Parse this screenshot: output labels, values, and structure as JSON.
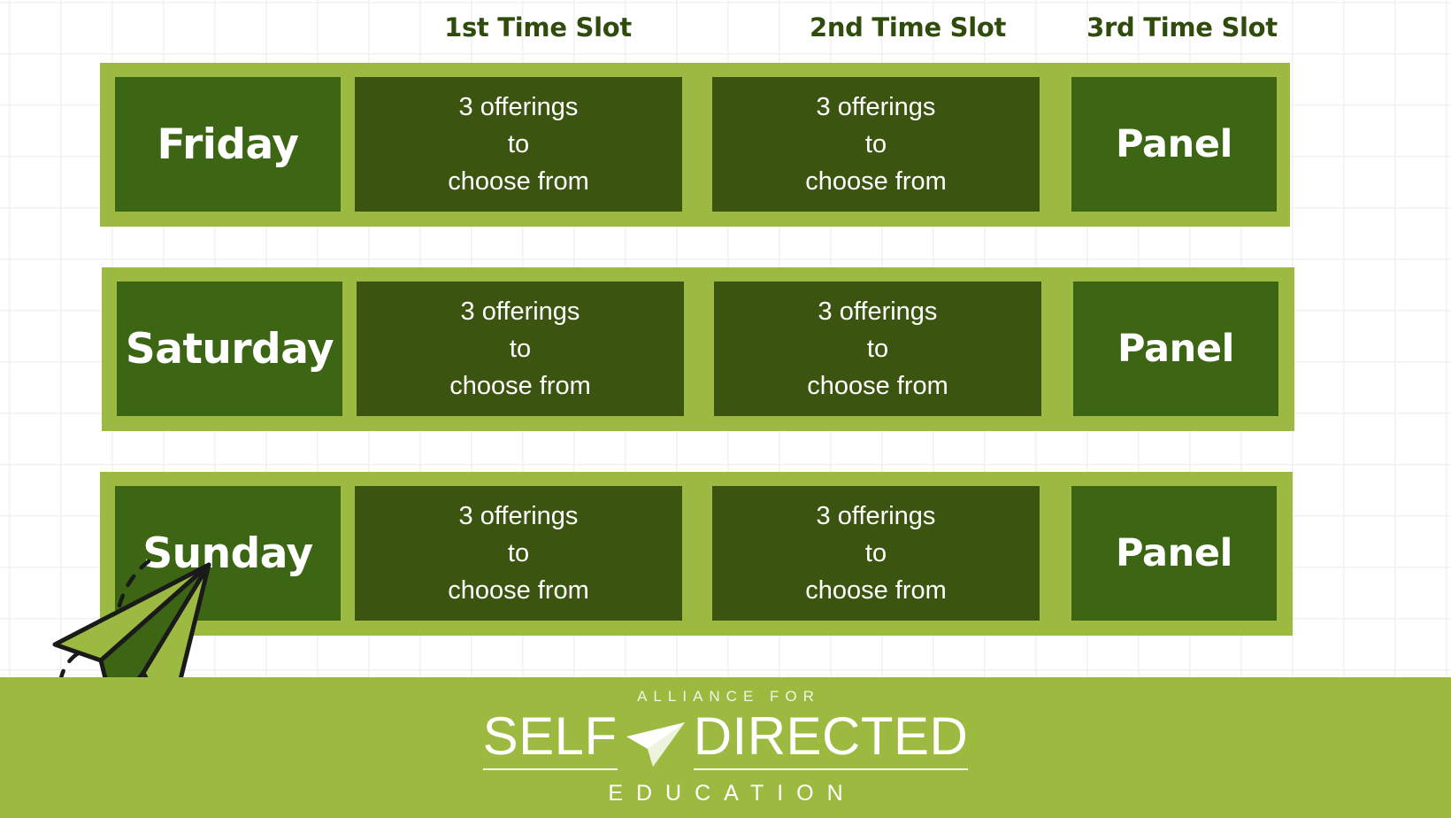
{
  "colors": {
    "band_green": "#9cba41",
    "cell_dark_green": "#3c6614",
    "cell_olive_green": "#3b540f",
    "header_text_green": "#2f4c0c",
    "footer_green": "#9bba3f",
    "text_white": "#ffffff",
    "grid_line": "#f1f1f1",
    "page_background": "#ffffff",
    "plane_light": "#9cba41",
    "plane_dark": "#3c6614",
    "plane_outline": "#1a1a1a"
  },
  "headers": [
    {
      "label": "1st Time Slot"
    },
    {
      "label": "2nd Time Slot"
    },
    {
      "label": "3rd Time Slot"
    }
  ],
  "rows": [
    {
      "day": "Friday",
      "slot1": {
        "line1": "3 offerings",
        "line2": "to",
        "line3": "choose from"
      },
      "slot2": {
        "line1": "3 offerings",
        "line2": "to",
        "line3": "choose from"
      },
      "slot3": "Panel"
    },
    {
      "day": "Saturday",
      "slot1": {
        "line1": "3 offerings",
        "line2": "to",
        "line3": "choose from"
      },
      "slot2": {
        "line1": "3 offerings",
        "line2": "to",
        "line3": "choose from"
      },
      "slot3": "Panel"
    },
    {
      "day": "Sunday",
      "slot1": {
        "line1": "3 offerings",
        "line2": "to",
        "line3": "choose from"
      },
      "slot2": {
        "line1": "3 offerings",
        "line2": "to",
        "line3": "choose from"
      },
      "slot3": "Panel"
    }
  ],
  "footer": {
    "logo": {
      "tagline": "ALLIANCE FOR",
      "word1": "SELF",
      "word2": "DIRECTED",
      "subtitle": "EDUCATION",
      "icon": "paper-plane-icon"
    }
  },
  "decoration": {
    "plane_icon": "paper-plane-icon",
    "trail_icon": "dashed-loop-trail-icon"
  }
}
